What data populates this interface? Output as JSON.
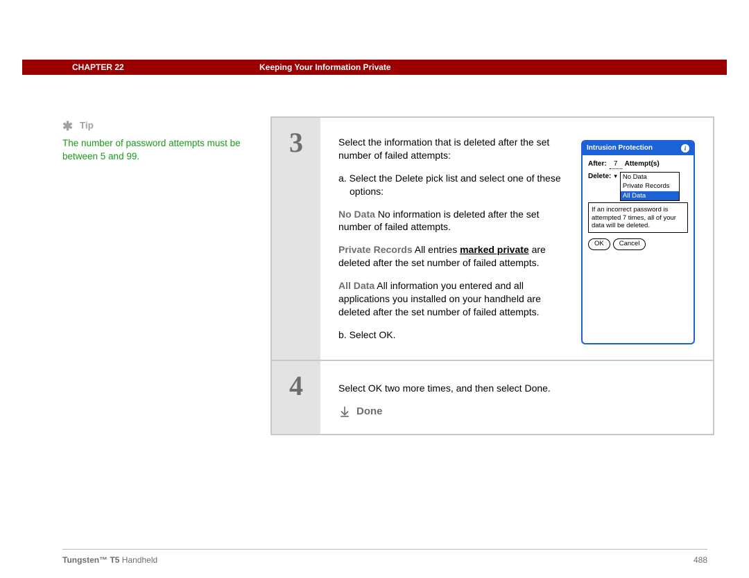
{
  "header": {
    "chapter_label": "CHAPTER 22",
    "title": "Keeping Your Information Private"
  },
  "tip": {
    "label": "Tip",
    "body": "The number of password attempts must be between 5 and 99."
  },
  "step3": {
    "number": "3",
    "intro": "Select the information that is deleted after the set number of failed attempts:",
    "sub_a": "a.  Select the Delete pick list and select one of these options:",
    "nodata_label": "No Data",
    "nodata_text": "   No information is deleted after the set number of failed attempts.",
    "priv_label": "Private Records",
    "priv_text_pre": "   All entries ",
    "priv_link": "marked private",
    "priv_text_post": " are deleted after the set number of failed attempts.",
    "all_label": "All Data",
    "all_text": "   All information you entered and all applications you installed on your handheld are deleted after the set number of failed attempts.",
    "sub_b": "b.  Select OK."
  },
  "palm": {
    "title": "Intrusion Protection",
    "after_label": "After:",
    "after_value": "7",
    "attempts_label": "Attempt(s)",
    "delete_label": "Delete:",
    "options": {
      "nodata": "No Data",
      "private": "Private Records",
      "all": "All Data"
    },
    "note": "If an incorrect password is attempted 7 times, all of your data will be deleted.",
    "ok": "OK",
    "cancel": "Cancel"
  },
  "step4": {
    "number": "4",
    "text": "Select OK two more times, and then select Done.",
    "done": "Done"
  },
  "footer": {
    "product_bold": "Tungsten™ T5",
    "product_rest": " Handheld",
    "page": "488"
  }
}
